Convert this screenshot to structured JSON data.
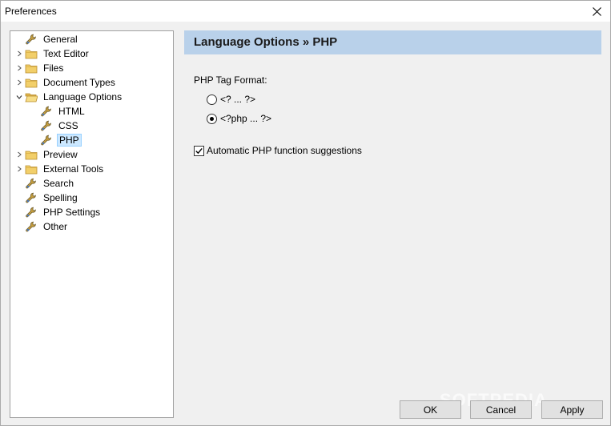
{
  "window": {
    "title": "Preferences"
  },
  "tree": {
    "items": [
      {
        "label": "General",
        "icon": "wrench-icon",
        "expander": "none",
        "level": 0
      },
      {
        "label": "Text Editor",
        "icon": "folder-icon",
        "expander": "collapsed",
        "level": 0
      },
      {
        "label": "Files",
        "icon": "folder-icon",
        "expander": "collapsed",
        "level": 0
      },
      {
        "label": "Document Types",
        "icon": "folder-icon",
        "expander": "collapsed",
        "level": 0
      },
      {
        "label": "Language Options",
        "icon": "folder-open-icon",
        "expander": "expanded",
        "level": 0
      },
      {
        "label": "HTML",
        "icon": "wrench-icon",
        "expander": "none",
        "level": 1
      },
      {
        "label": "CSS",
        "icon": "wrench-icon",
        "expander": "none",
        "level": 1
      },
      {
        "label": "PHP",
        "icon": "wrench-icon",
        "expander": "none",
        "level": 1,
        "selected": true
      },
      {
        "label": "Preview",
        "icon": "folder-icon",
        "expander": "collapsed",
        "level": 0
      },
      {
        "label": "External Tools",
        "icon": "folder-icon",
        "expander": "collapsed",
        "level": 0
      },
      {
        "label": "Search",
        "icon": "wrench-icon",
        "expander": "none",
        "level": 0
      },
      {
        "label": "Spelling",
        "icon": "wrench-icon",
        "expander": "none",
        "level": 0
      },
      {
        "label": "PHP Settings",
        "icon": "wrench-icon",
        "expander": "none",
        "level": 0
      },
      {
        "label": "Other",
        "icon": "wrench-icon",
        "expander": "none",
        "level": 0
      }
    ]
  },
  "panel": {
    "title": "Language Options » PHP",
    "tag_format_label": "PHP Tag Format:",
    "options": [
      {
        "label": "<? ... ?>",
        "checked": false
      },
      {
        "label": "<?php ... ?>",
        "checked": true
      }
    ],
    "suggestions_label": "Automatic PHP function suggestions",
    "suggestions_checked": true
  },
  "buttons": {
    "ok": "OK",
    "cancel": "Cancel",
    "apply": "Apply"
  },
  "watermark": "SOFTPEDIA",
  "colors": {
    "header_band": "#b9d1ea",
    "selection": "#cce8ff",
    "folder": "#e8c062"
  }
}
